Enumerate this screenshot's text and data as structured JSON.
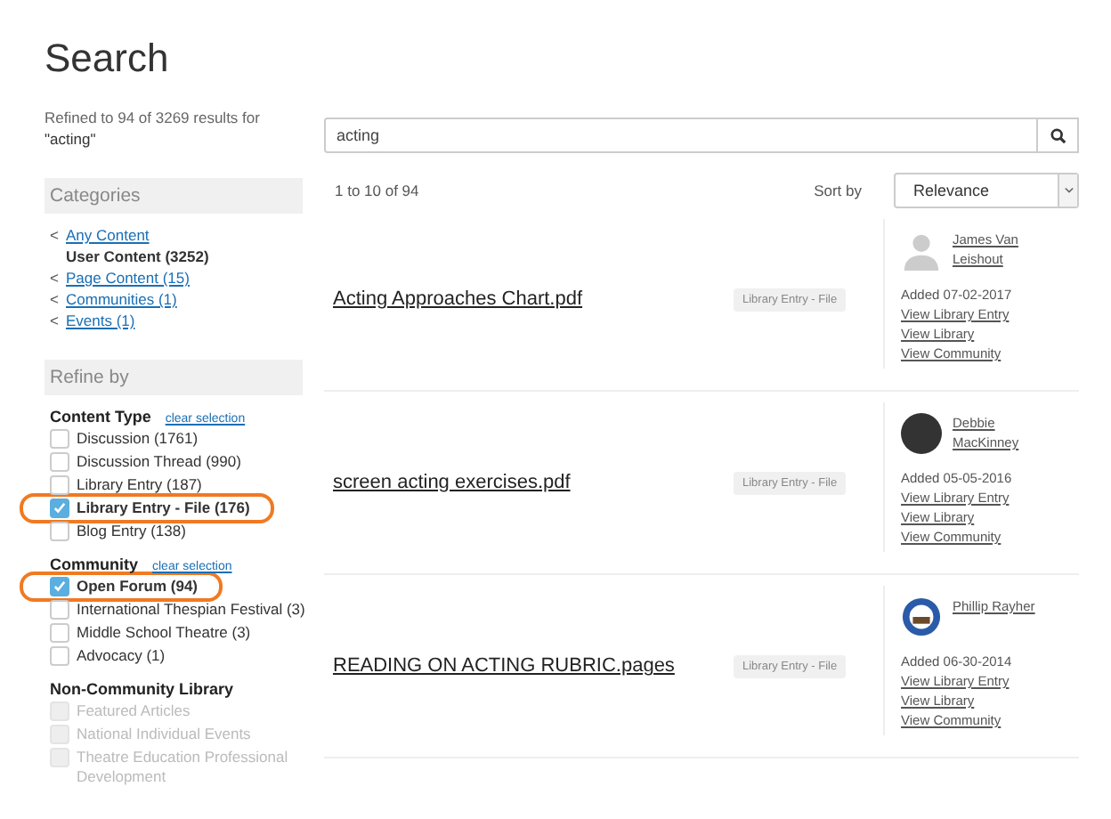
{
  "page_title": "Search",
  "refined_text": "Refined to 94 of 3269 results for",
  "refined_query": "\"acting\"",
  "categories": {
    "title": "Categories",
    "items": [
      {
        "prefix": "<",
        "label": "Any Content",
        "kind": "link"
      },
      {
        "label": "User Content (3252)",
        "kind": "current"
      },
      {
        "prefix": "<",
        "label": "Page Content (15)",
        "kind": "link"
      },
      {
        "prefix": "<",
        "label": "Communities (1)",
        "kind": "link"
      },
      {
        "prefix": "<",
        "label": "Events (1)",
        "kind": "link"
      }
    ]
  },
  "refine": {
    "title": "Refine by",
    "groups": [
      {
        "title": "Content Type",
        "clear_label": "clear selection",
        "options": [
          {
            "label": "Discussion (1761)",
            "checked": false,
            "disabled": false,
            "highlighted": false
          },
          {
            "label": "Discussion Thread (990)",
            "checked": false,
            "disabled": false,
            "highlighted": false
          },
          {
            "label": "Library Entry (187)",
            "checked": false,
            "disabled": false,
            "highlighted": false
          },
          {
            "label": "Library Entry - File (176)",
            "checked": true,
            "disabled": false,
            "highlighted": true
          },
          {
            "label": "Blog Entry (138)",
            "checked": false,
            "disabled": false,
            "highlighted": false
          }
        ]
      },
      {
        "title": "Community",
        "clear_label": "clear selection",
        "options": [
          {
            "label": "Open Forum (94)",
            "checked": true,
            "disabled": false,
            "highlighted": true
          },
          {
            "label": "International Thespian Festival (3)",
            "checked": false,
            "disabled": false,
            "highlighted": false
          },
          {
            "label": "Middle School Theatre (3)",
            "checked": false,
            "disabled": false,
            "highlighted": false
          },
          {
            "label": "Advocacy (1)",
            "checked": false,
            "disabled": false,
            "highlighted": false
          }
        ]
      },
      {
        "title": "Non-Community Library",
        "options": [
          {
            "label": "Featured Articles",
            "checked": false,
            "disabled": true,
            "highlighted": false
          },
          {
            "label": "National Individual Events",
            "checked": false,
            "disabled": true,
            "highlighted": false
          },
          {
            "label": "Theatre Education Professional Development",
            "checked": false,
            "disabled": true,
            "highlighted": false
          }
        ]
      }
    ]
  },
  "search": {
    "value": "acting"
  },
  "results_count": "1 to 10 of 94",
  "sort": {
    "label": "Sort by",
    "value": "Relevance"
  },
  "results": [
    {
      "title": "Acting Approaches Chart.pdf",
      "tag": "Library Entry - File",
      "author": "James Van Leishout",
      "avatar": {
        "kind": "silhouette"
      },
      "added": "Added 07-02-2017",
      "links": [
        "View Library Entry",
        "View Library",
        "View Community"
      ]
    },
    {
      "title": "screen acting exercises.pdf",
      "tag": "Library Entry - File",
      "author": "Debbie MacKinney",
      "avatar": {
        "kind": "photo"
      },
      "added": "Added 05-05-2016",
      "links": [
        "View Library Entry",
        "View Library",
        "View Community"
      ]
    },
    {
      "title": "READING ON ACTING RUBRIC.pages",
      "tag": "Library Entry - File",
      "author": "Phillip Rayher",
      "avatar": {
        "kind": "emblem"
      },
      "added": "Added 06-30-2014",
      "links": [
        "View Library Entry",
        "View Library",
        "View Community"
      ]
    }
  ]
}
